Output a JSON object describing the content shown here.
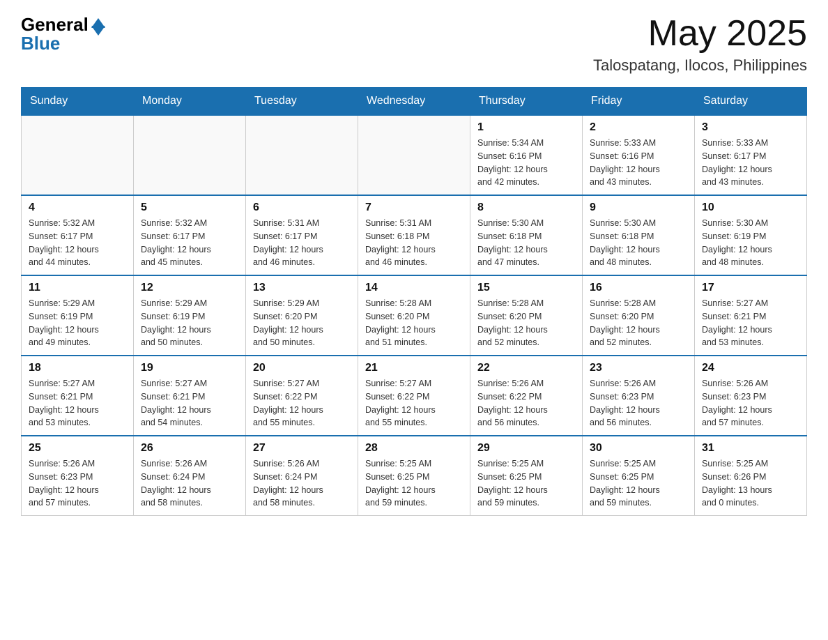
{
  "header": {
    "logo_general": "General",
    "logo_blue": "Blue",
    "month_year": "May 2025",
    "location": "Talospatang, Ilocos, Philippines"
  },
  "days_of_week": [
    "Sunday",
    "Monday",
    "Tuesday",
    "Wednesday",
    "Thursday",
    "Friday",
    "Saturday"
  ],
  "weeks": [
    [
      {
        "day": "",
        "info": ""
      },
      {
        "day": "",
        "info": ""
      },
      {
        "day": "",
        "info": ""
      },
      {
        "day": "",
        "info": ""
      },
      {
        "day": "1",
        "info": "Sunrise: 5:34 AM\nSunset: 6:16 PM\nDaylight: 12 hours\nand 42 minutes."
      },
      {
        "day": "2",
        "info": "Sunrise: 5:33 AM\nSunset: 6:16 PM\nDaylight: 12 hours\nand 43 minutes."
      },
      {
        "day": "3",
        "info": "Sunrise: 5:33 AM\nSunset: 6:17 PM\nDaylight: 12 hours\nand 43 minutes."
      }
    ],
    [
      {
        "day": "4",
        "info": "Sunrise: 5:32 AM\nSunset: 6:17 PM\nDaylight: 12 hours\nand 44 minutes."
      },
      {
        "day": "5",
        "info": "Sunrise: 5:32 AM\nSunset: 6:17 PM\nDaylight: 12 hours\nand 45 minutes."
      },
      {
        "day": "6",
        "info": "Sunrise: 5:31 AM\nSunset: 6:17 PM\nDaylight: 12 hours\nand 46 minutes."
      },
      {
        "day": "7",
        "info": "Sunrise: 5:31 AM\nSunset: 6:18 PM\nDaylight: 12 hours\nand 46 minutes."
      },
      {
        "day": "8",
        "info": "Sunrise: 5:30 AM\nSunset: 6:18 PM\nDaylight: 12 hours\nand 47 minutes."
      },
      {
        "day": "9",
        "info": "Sunrise: 5:30 AM\nSunset: 6:18 PM\nDaylight: 12 hours\nand 48 minutes."
      },
      {
        "day": "10",
        "info": "Sunrise: 5:30 AM\nSunset: 6:19 PM\nDaylight: 12 hours\nand 48 minutes."
      }
    ],
    [
      {
        "day": "11",
        "info": "Sunrise: 5:29 AM\nSunset: 6:19 PM\nDaylight: 12 hours\nand 49 minutes."
      },
      {
        "day": "12",
        "info": "Sunrise: 5:29 AM\nSunset: 6:19 PM\nDaylight: 12 hours\nand 50 minutes."
      },
      {
        "day": "13",
        "info": "Sunrise: 5:29 AM\nSunset: 6:20 PM\nDaylight: 12 hours\nand 50 minutes."
      },
      {
        "day": "14",
        "info": "Sunrise: 5:28 AM\nSunset: 6:20 PM\nDaylight: 12 hours\nand 51 minutes."
      },
      {
        "day": "15",
        "info": "Sunrise: 5:28 AM\nSunset: 6:20 PM\nDaylight: 12 hours\nand 52 minutes."
      },
      {
        "day": "16",
        "info": "Sunrise: 5:28 AM\nSunset: 6:20 PM\nDaylight: 12 hours\nand 52 minutes."
      },
      {
        "day": "17",
        "info": "Sunrise: 5:27 AM\nSunset: 6:21 PM\nDaylight: 12 hours\nand 53 minutes."
      }
    ],
    [
      {
        "day": "18",
        "info": "Sunrise: 5:27 AM\nSunset: 6:21 PM\nDaylight: 12 hours\nand 53 minutes."
      },
      {
        "day": "19",
        "info": "Sunrise: 5:27 AM\nSunset: 6:21 PM\nDaylight: 12 hours\nand 54 minutes."
      },
      {
        "day": "20",
        "info": "Sunrise: 5:27 AM\nSunset: 6:22 PM\nDaylight: 12 hours\nand 55 minutes."
      },
      {
        "day": "21",
        "info": "Sunrise: 5:27 AM\nSunset: 6:22 PM\nDaylight: 12 hours\nand 55 minutes."
      },
      {
        "day": "22",
        "info": "Sunrise: 5:26 AM\nSunset: 6:22 PM\nDaylight: 12 hours\nand 56 minutes."
      },
      {
        "day": "23",
        "info": "Sunrise: 5:26 AM\nSunset: 6:23 PM\nDaylight: 12 hours\nand 56 minutes."
      },
      {
        "day": "24",
        "info": "Sunrise: 5:26 AM\nSunset: 6:23 PM\nDaylight: 12 hours\nand 57 minutes."
      }
    ],
    [
      {
        "day": "25",
        "info": "Sunrise: 5:26 AM\nSunset: 6:23 PM\nDaylight: 12 hours\nand 57 minutes."
      },
      {
        "day": "26",
        "info": "Sunrise: 5:26 AM\nSunset: 6:24 PM\nDaylight: 12 hours\nand 58 minutes."
      },
      {
        "day": "27",
        "info": "Sunrise: 5:26 AM\nSunset: 6:24 PM\nDaylight: 12 hours\nand 58 minutes."
      },
      {
        "day": "28",
        "info": "Sunrise: 5:25 AM\nSunset: 6:25 PM\nDaylight: 12 hours\nand 59 minutes."
      },
      {
        "day": "29",
        "info": "Sunrise: 5:25 AM\nSunset: 6:25 PM\nDaylight: 12 hours\nand 59 minutes."
      },
      {
        "day": "30",
        "info": "Sunrise: 5:25 AM\nSunset: 6:25 PM\nDaylight: 12 hours\nand 59 minutes."
      },
      {
        "day": "31",
        "info": "Sunrise: 5:25 AM\nSunset: 6:26 PM\nDaylight: 13 hours\nand 0 minutes."
      }
    ]
  ]
}
